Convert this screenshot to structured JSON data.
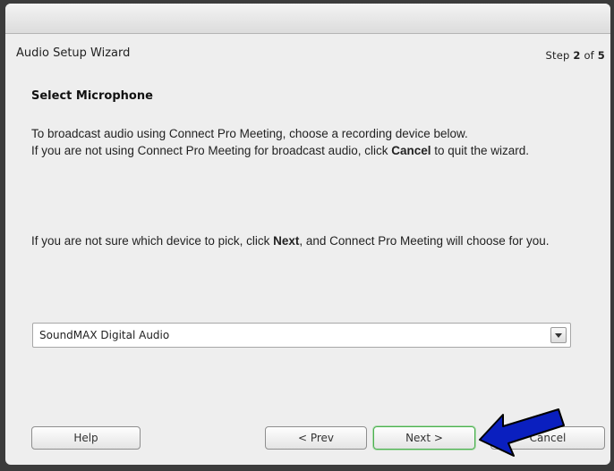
{
  "wizard": {
    "title": "Audio Setup Wizard",
    "step_prefix": "Step ",
    "step_current": "2",
    "step_of": " of ",
    "step_total": "5"
  },
  "content": {
    "heading": "Select Microphone",
    "p1_line1": "To broadcast audio using Connect Pro Meeting, choose a recording device below.",
    "p1_line2_pre": "If you are not using Connect Pro Meeting for broadcast audio, click ",
    "p1_line2_bold": "Cancel",
    "p1_line2_post": " to quit the wizard.",
    "p2_pre": "If you are not sure which device to pick, click ",
    "p2_bold": "Next",
    "p2_post": ", and Connect Pro Meeting will choose for you."
  },
  "device_select": {
    "selected": "SoundMAX Digital Audio"
  },
  "buttons": {
    "help": "Help",
    "prev": "< Prev",
    "next": "Next >",
    "cancel": "Cancel"
  },
  "colors": {
    "arrow": "#0a1fbf",
    "next_focus": "#4caf50"
  },
  "icons": {
    "dropdown": "chevron-down-icon",
    "pointer": "arrow-pointer-icon"
  }
}
